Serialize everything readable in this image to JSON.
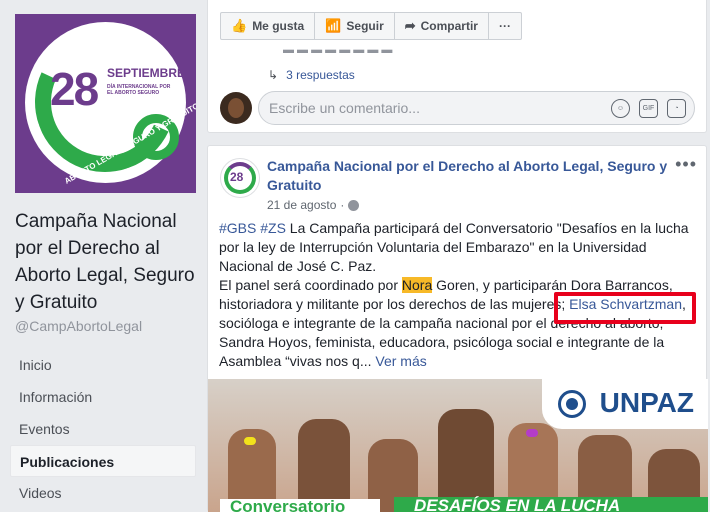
{
  "sidebar": {
    "page_name": "Campaña Nacional por el Derecho al Aborto Legal, Seguro y Gratuito",
    "handle": "@CampAbortoLegal",
    "profile_image": {
      "number": "28",
      "month": "SEPTIEMBRE",
      "subtitle": "DÍA INTERNACIONAL POR EL ABORTO SEGURO",
      "ring_text": "ABORTO LEGAL, SEGURO Y GRATUITO"
    },
    "nav": [
      {
        "label": "Inicio",
        "active": false
      },
      {
        "label": "Información",
        "active": false
      },
      {
        "label": "Eventos",
        "active": false
      },
      {
        "label": "Publicaciones",
        "active": true
      },
      {
        "label": "Videos",
        "active": false
      }
    ]
  },
  "post1": {
    "actions": {
      "like": "Me gusta",
      "follow": "Seguir",
      "share": "Compartir",
      "more": "···"
    },
    "replies": "3 respuestas",
    "comment_placeholder": "Escribe un comentario..."
  },
  "post2": {
    "title": "Campaña Nacional por el Derecho al Aborto Legal, Seguro y Gratuito",
    "date": "21 de agosto",
    "date_sep": "·",
    "more": "•••",
    "body": {
      "line1_tags": "#GBS #ZS",
      "line1_text": " La Campaña participará del Conversatorio \"Desafíos en la lucha",
      "line2": "por la ley de Interrupción Voluntaria del Embarazo\" en la Universidad",
      "line3": "Nacional de José C. Paz.",
      "line4_pre": "El panel será coordinado por ",
      "line4_hl": "Nora",
      "line4_post": " Goren, y participarán Dora Barrancos,",
      "line5_pre": "historiadora y militante por los derechos de las mujeres; ",
      "line5_link": "Elsa Schvartzman",
      "line5_post": ",",
      "line6": "socióloga e integrante de la campaña nacional por el derecho al aborto;",
      "line7": "Sandra Hoyos, feminista, educadora, psicóloga social e integrante de la",
      "line8_pre": "Asamblea “vivas nos q... ",
      "see_more": "Ver más"
    },
    "image": {
      "brand": "UNPAZ",
      "banner_left": "Conversatorio",
      "banner_right": "DESAFÍOS EN LA LUCHA"
    }
  },
  "colors": {
    "link": "#385898",
    "highlight": "#f7b928",
    "annotation_box": "#e8001c",
    "brand_purple": "#6c3c8c",
    "brand_green": "#2eaa4a"
  },
  "icons": [
    "like-icon",
    "follow-icon",
    "share-icon",
    "reply-arrow-icon",
    "emoji-icon",
    "gif-icon",
    "sticker-icon",
    "globe-icon"
  ]
}
